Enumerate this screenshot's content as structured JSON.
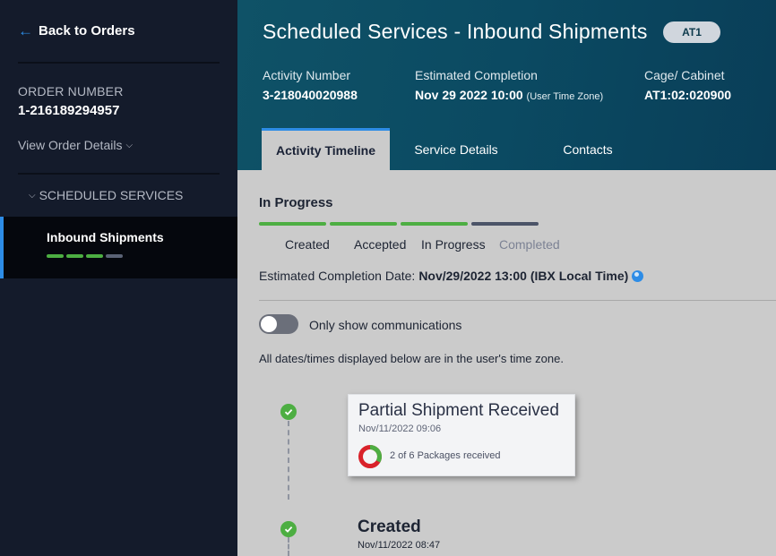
{
  "sidebar": {
    "back_label": "Back to Orders",
    "order_label": "ORDER NUMBER",
    "order_number": "1-216189294957",
    "view_details": "View Order Details",
    "section_label": "SCHEDULED SERVICES",
    "active_item": {
      "label": "Inbound Shipments",
      "progress_steps_done": 3,
      "progress_steps_total": 4
    }
  },
  "header": {
    "title": "Scheduled Services - Inbound Shipments",
    "badge": "AT1",
    "activity_number_label": "Activity Number",
    "activity_number": "3-218040020988",
    "est_completion_label": "Estimated Completion",
    "est_completion": "Nov 29 2022 10:00",
    "est_completion_tz": "(User Time Zone)",
    "cage_label": "Cage/ Cabinet",
    "cage": "AT1:02:020900",
    "tabs": [
      {
        "label": "Activity Timeline",
        "active": true
      },
      {
        "label": "Service Details",
        "active": false
      },
      {
        "label": "Contacts",
        "active": false
      }
    ]
  },
  "main": {
    "status_title": "In Progress",
    "steps": [
      {
        "label": "Created",
        "done": true
      },
      {
        "label": "Accepted",
        "done": true
      },
      {
        "label": "In Progress",
        "done": true
      },
      {
        "label": "Completed",
        "done": false
      }
    ],
    "est_label": "Estimated Completion Date:",
    "est_value": "Nov/29/2022 13:00 (IBX Local Time)",
    "toggle_label": "Only show communications",
    "toggle_on": false,
    "tz_note": "All dates/times displayed below are in the user's time zone.",
    "events": [
      {
        "title": "Partial Shipment Received",
        "date": "Nov/11/2022 09:06",
        "packages_text": "2 of 6 Packages received",
        "received": 2,
        "total": 6
      },
      {
        "title": "Created",
        "date": "Nov/11/2022 08:47"
      }
    ]
  },
  "colors": {
    "accent": "#2d8ce6",
    "success": "#4dae42",
    "pending": "#4b5468",
    "donut_remaining": "#d9222a"
  },
  "icons": {
    "back": "arrow-left-icon",
    "chevron": "chevron-down-icon",
    "globe": "globe-icon",
    "check": "check-circle-icon"
  }
}
